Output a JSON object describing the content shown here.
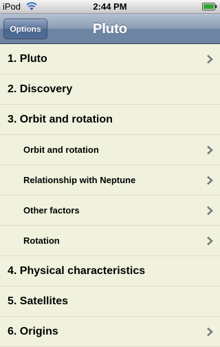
{
  "status_bar": {
    "carrier": "iPod",
    "time": "2:44 PM"
  },
  "nav_bar": {
    "options_label": "Options",
    "title": "Pluto"
  },
  "list": {
    "items": [
      {
        "label": "1. Pluto",
        "level": "top",
        "chevron": true
      },
      {
        "label": "2. Discovery",
        "level": "top",
        "chevron": false
      },
      {
        "label": "3. Orbit and rotation",
        "level": "top",
        "chevron": false
      },
      {
        "label": "Orbit and rotation",
        "level": "sub",
        "chevron": true
      },
      {
        "label": "Relationship with Neptune",
        "level": "sub",
        "chevron": true
      },
      {
        "label": "Other factors",
        "level": "sub",
        "chevron": true
      },
      {
        "label": "Rotation",
        "level": "sub",
        "chevron": true
      },
      {
        "label": "4. Physical characteristics",
        "level": "top",
        "chevron": false
      },
      {
        "label": "5. Satellites",
        "level": "top",
        "chevron": false
      },
      {
        "label": "6. Origins",
        "level": "top",
        "chevron": true
      }
    ]
  },
  "colors": {
    "list_background": "#f1f2dd",
    "nav_bar": "#6d84a2",
    "chevron": "#7a7a7a"
  }
}
